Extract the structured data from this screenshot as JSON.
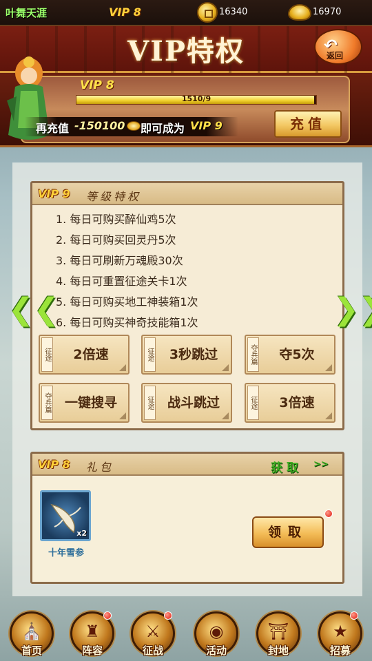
{
  "topbar": {
    "player_name": "叶舞天涯",
    "vip": "VIP 8",
    "coins": "16340",
    "ingots": "16970"
  },
  "header": {
    "title": "VIP特权",
    "back_label": "返回"
  },
  "banner": {
    "vip": "VIP 8",
    "progress_text": "1510/9",
    "progress_fraction": 0.99,
    "recharge_prefix": "再充值",
    "recharge_amount": "-150100",
    "recharge_middle": "即可成为",
    "target_vip": "VIP 9",
    "recharge_button": "充值"
  },
  "privileges": {
    "vip": "VIP 9",
    "title": "等级特权",
    "items": [
      "1. 每日可购买醉仙鸡5次",
      "2. 每日可购买回灵丹5次",
      "3. 每日可刷新万魂殿30次",
      "4. 每日可重置征途关卡1次",
      "5. 每日可购买地工神装箱1次",
      "6. 每日可购买神奇技能箱1次"
    ],
    "features": [
      {
        "tag": "征途",
        "label": "2倍速"
      },
      {
        "tag": "征途",
        "label": "3秒跳过"
      },
      {
        "tag": "夺兵篇",
        "label": "夺5次"
      },
      {
        "tag": "夺兵篇",
        "label": "一键搜寻"
      },
      {
        "tag": "征途",
        "label": "战斗跳过"
      },
      {
        "tag": "征途",
        "label": "3倍速"
      }
    ]
  },
  "gift": {
    "vip": "VIP 8",
    "title": "礼包",
    "get_link": "获取",
    "get_arrow": ">>",
    "item_name": "十年雪参",
    "item_count": "x2",
    "claim_button": "领取"
  },
  "nav": {
    "items": [
      {
        "label": "首页",
        "icon": "palace-icon"
      },
      {
        "label": "阵容",
        "icon": "helmet-icon"
      },
      {
        "label": "征战",
        "icon": "crossed-swords-icon"
      },
      {
        "label": "活动",
        "icon": "drum-icon"
      },
      {
        "label": "封地",
        "icon": "castle-icon"
      },
      {
        "label": "招募",
        "icon": "recruit-icon"
      }
    ]
  },
  "colors": {
    "vip_gold": "#ffd23b",
    "accent_green": "#3eae22",
    "badge_red": "#e0180c"
  }
}
